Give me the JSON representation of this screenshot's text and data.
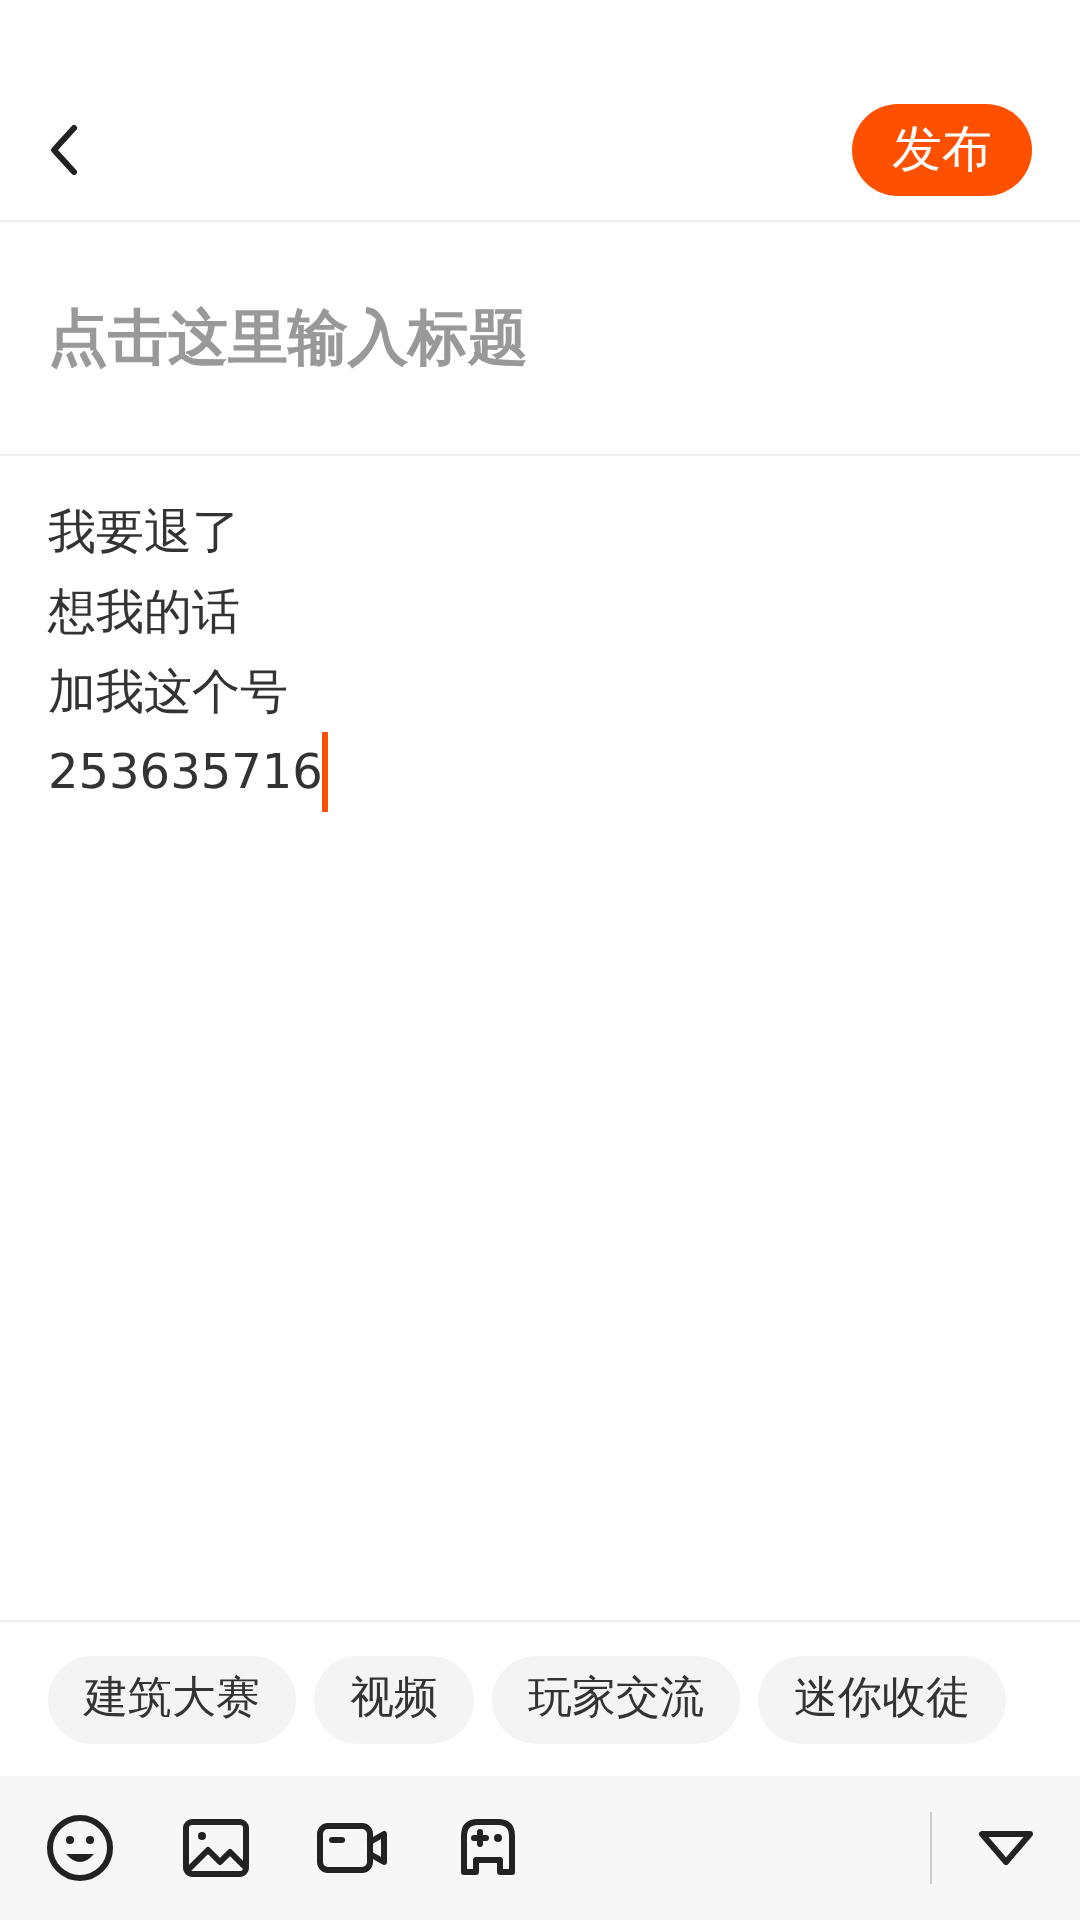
{
  "header": {
    "publish_button": "发布"
  },
  "title_field": {
    "placeholder": "点击这里输入标题"
  },
  "body": {
    "lines": [
      "我要退了",
      "想我的话",
      "加我这个号",
      "253635716"
    ]
  },
  "tags": [
    "建筑大赛",
    "视频",
    "玩家交流",
    "迷你收徒"
  ],
  "toolbar": {
    "tools": [
      {
        "kind": "emoji"
      },
      {
        "kind": "image"
      },
      {
        "kind": "video"
      },
      {
        "kind": "game"
      }
    ]
  }
}
